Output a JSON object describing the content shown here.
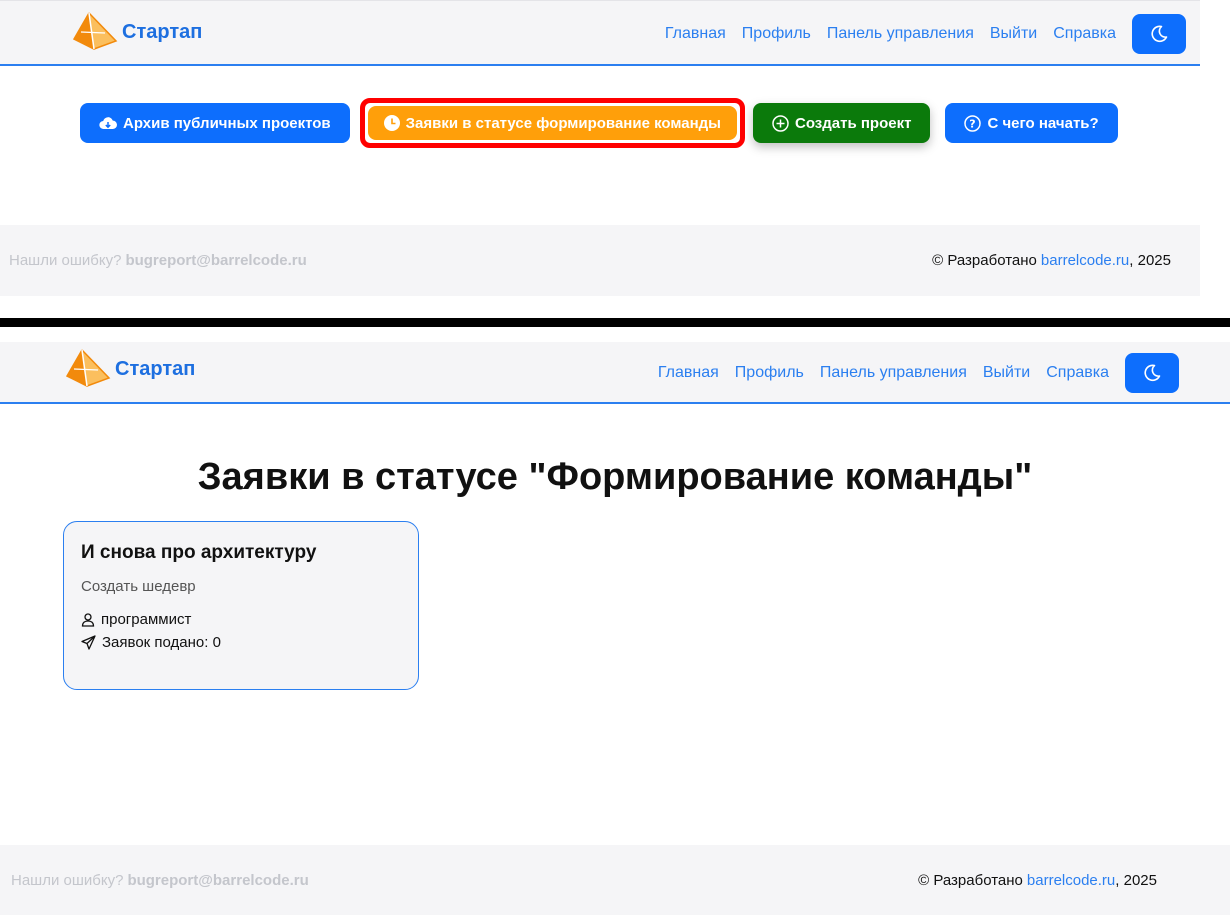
{
  "brand": {
    "name": "Стартап",
    "logo_icon": "pyramid-logo-icon",
    "logo_colors": [
      "#f28a0c",
      "#fbbf5e",
      "#ffffff"
    ]
  },
  "nav": {
    "items": [
      "Главная",
      "Профиль",
      "Панель управления",
      "Выйти",
      "Справка"
    ],
    "theme_toggle_icon": "moon-icon"
  },
  "actions": {
    "archive_label": "Архив публичных проектов",
    "team_requests_label": "Заявки в статусе формирование команды",
    "create_project_label": "Создать проект",
    "getting_started_label": "С чего начать?"
  },
  "footer": {
    "bug_prompt": "Нашли ошибку?",
    "bug_email": "bugreport@barrelcode.ru",
    "dev_prefix": "© Разработано",
    "dev_link": "barrelcode.ru",
    "dev_suffix": ", 2025"
  },
  "requests_page": {
    "title": "Заявки в статусе \"Формирование команды\"",
    "cards": [
      {
        "title": "И снова про архитектуру",
        "subtitle": "Создать шедевр",
        "role": "программист",
        "applications": "Заявок подано: 0"
      }
    ]
  },
  "colors": {
    "primary": "#0d6efd",
    "link": "#2b7ff0",
    "orange": "#ff9f0a",
    "green": "#0b7a0b",
    "highlight": "#ff0000",
    "navbar_bg": "#f5f5f7"
  }
}
